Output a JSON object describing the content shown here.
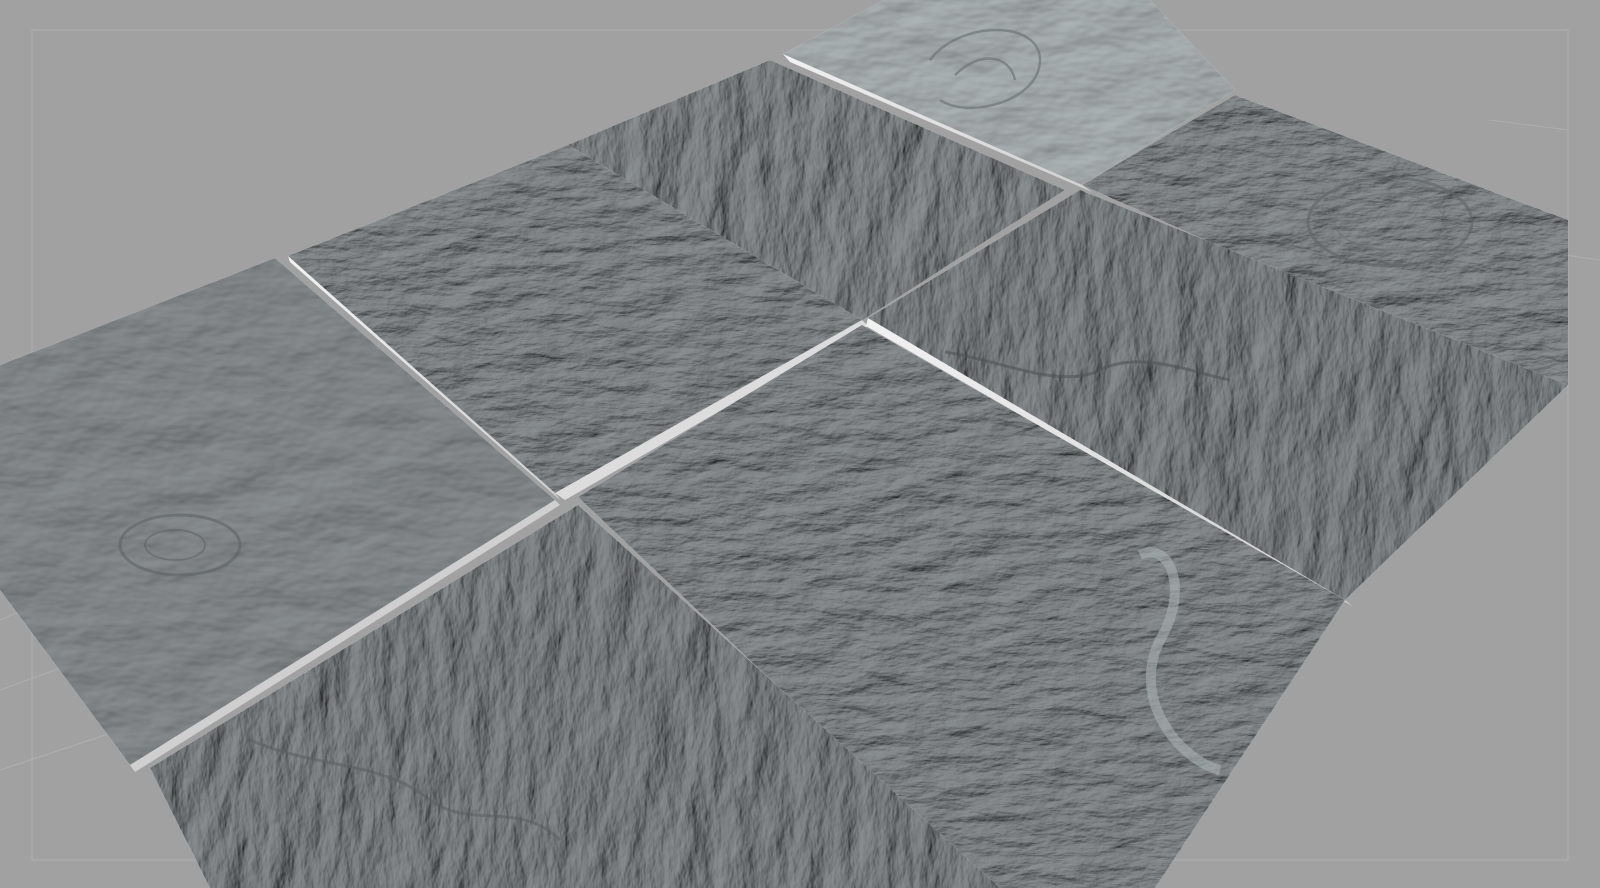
{
  "app": {
    "view": "3D viewport",
    "background_color": "#a1a1a1",
    "grid_color": "#b4b4b4"
  },
  "scene": {
    "object_type": "relief terrain tiles",
    "tile_count": 7,
    "tile_color": "#8c9194",
    "highlighted_tile_color": "#b3babb",
    "base_color": "#e8e8e8",
    "tiles": [
      {
        "name": "tile-top-center",
        "selected": true
      },
      {
        "name": "tile-upper-middle",
        "selected": false
      },
      {
        "name": "tile-upper-left",
        "selected": false
      },
      {
        "name": "tile-left",
        "selected": false
      },
      {
        "name": "tile-right",
        "selected": false
      },
      {
        "name": "tile-center",
        "selected": false
      },
      {
        "name": "tile-bottom-left",
        "selected": false
      }
    ]
  }
}
